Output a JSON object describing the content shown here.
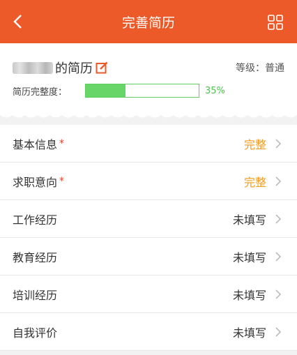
{
  "header": {
    "title": "完善简历",
    "background": "#ec5a2a"
  },
  "profile": {
    "name_suffix": "的简历",
    "grade_label": "等级：普通",
    "completeness_label": "简历完整度：",
    "completeness_percent": "35%",
    "completeness_value": 0.35
  },
  "sections": [
    {
      "label": "基本信息",
      "required": "*",
      "status": "完整"
    },
    {
      "label": "求职意向",
      "required": "*",
      "status": "完整"
    },
    {
      "label": "工作经历",
      "required": "",
      "status": "未填写"
    },
    {
      "label": "教育经历",
      "required": "",
      "status": "未填写"
    },
    {
      "label": "培训经历",
      "required": "",
      "status": "未填写"
    },
    {
      "label": "自我评价",
      "required": "",
      "status": "未填写"
    }
  ],
  "colors": {
    "complete_status": "#f29a16",
    "progress": "#67d567",
    "required_star": "#e8412c"
  },
  "icons": {
    "back": "chevron-left-icon",
    "menu": "grid-icon",
    "edit": "edit-icon",
    "row": "chevron-right-icon"
  }
}
